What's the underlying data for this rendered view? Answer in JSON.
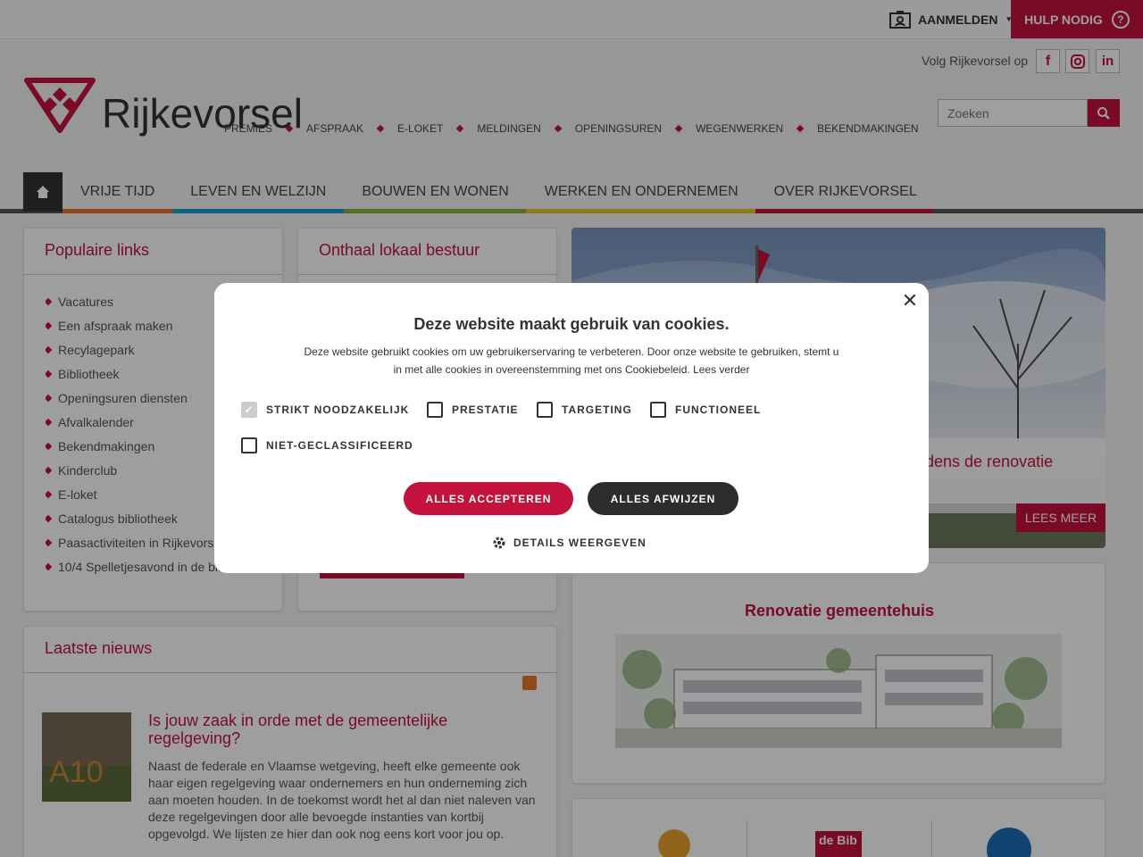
{
  "topbar": {
    "login_label": "AANMELDEN",
    "help_label": "HULP NODIG"
  },
  "header": {
    "follow_text": "Volg Rijkevorsel op",
    "social": [
      "facebook-icon",
      "instagram-icon",
      "linkedin-icon"
    ],
    "logo_text": "Rijkevorsel",
    "search_placeholder": "Zoeken",
    "quicklinks": [
      "PREMIES",
      "AFSPRAAK",
      "E-LOKET",
      "MELDINGEN",
      "OPENINGSUREN",
      "WEGENWERKEN",
      "BEKENDMAKINGEN"
    ]
  },
  "nav": {
    "items": [
      "VRIJE TIJD",
      "LEVEN EN WELZIJN",
      "BOUWEN EN WONEN",
      "WERKEN EN ONDERNEMEN",
      "OVER RIJKEVORSEL"
    ]
  },
  "colors": {
    "accent": "#c4123f",
    "nav_segments": [
      "#e8762c",
      "#1a9fd4",
      "#8bb33a",
      "#e5c72a",
      "#c4123f"
    ]
  },
  "popular_links": {
    "title": "Populaire links",
    "items": [
      "Vacatures",
      "Een afspraak maken",
      "Recylagepark",
      "Bibliotheek",
      "Openingsuren diensten",
      "Afvalkalender",
      "Bekendmakingen",
      "Kinderclub",
      "E-loket",
      "Catalogus bibliotheek",
      "Paasactiviteiten in Rijkevorsel",
      "10/4 Spelletjesavond in de bib"
    ]
  },
  "onthaal": {
    "title": "Onthaal lokaal bestuur"
  },
  "hero": {
    "caption": "tijdens de renovatie",
    "more_label": "LEES MEER"
  },
  "renovation": {
    "title": "Renovatie gemeentehuis"
  },
  "news": {
    "title": "Laatste nieuws",
    "item_title": "Is jouw zaak in orde met de gemeentelijke regelgeving?",
    "item_text": "Naast de federale en Vlaamse wetgeving, heeft elke gemeente ook haar eigen regelgeving waar ondernemers en hun onderneming zich aan moeten houden. In de toekomst wordt het al dan niet naleven van deze regelgevingen door alle bevoegde instanties van kortbij opgevolgd. We lijsten ze hier dan ook nog eens kort voor jou op."
  },
  "cookie": {
    "title": "Deze website maakt gebruik van cookies.",
    "text": "Deze website gebruikt cookies om uw gebruikerservaring te verbeteren. Door onze website te gebruiken, stemt u in met alle cookies in overeenstemming met ons Cookiebeleid. Lees verder",
    "options": [
      "STRIKT NOODZAKELIJK",
      "PRESTATIE",
      "TARGETING",
      "FUNCTIONEEL",
      "NIET-GECLASSIFICEERD"
    ],
    "accept_label": "ALLES ACCEPTEREN",
    "reject_label": "ALLES AFWIJZEN",
    "details_label": "DETAILS WEERGEVEN"
  }
}
